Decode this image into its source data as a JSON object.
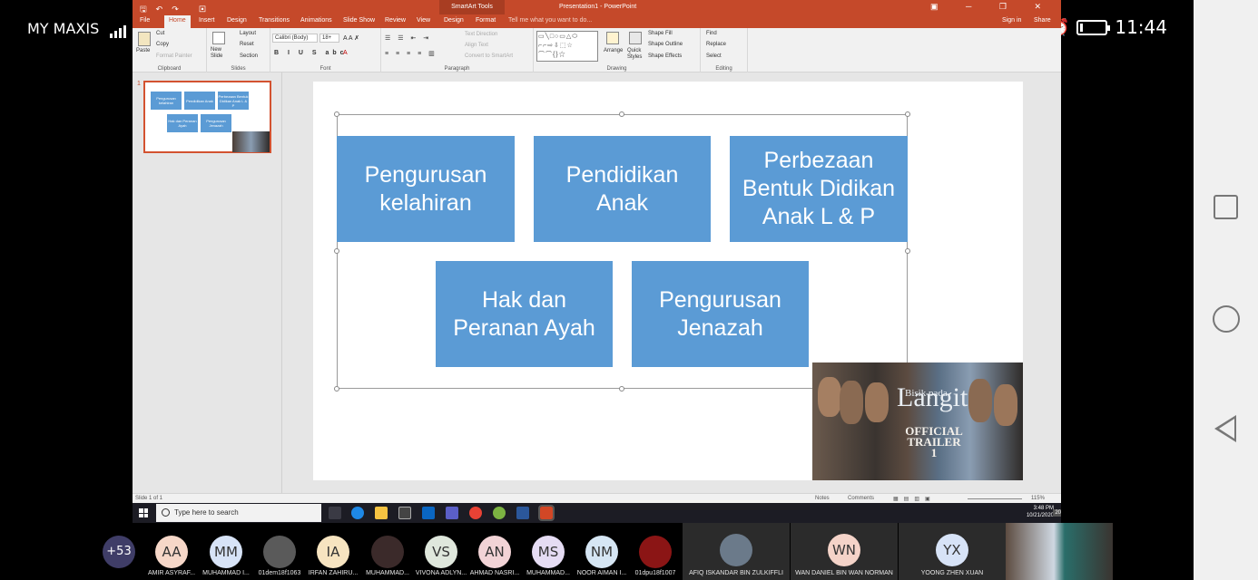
{
  "phone": {
    "carrier": "MY MAXIS",
    "clock": "11:44"
  },
  "ppt": {
    "window_title": "Presentation1 - PowerPoint",
    "context_group": "SmartArt Tools",
    "tabs": [
      "File",
      "Home",
      "Insert",
      "Design",
      "Transitions",
      "Animations",
      "Slide Show",
      "Review",
      "View",
      "Design",
      "Format"
    ],
    "tell_me": "Tell me what you want to do...",
    "sign_in": "Sign in",
    "share": "Share",
    "ribbon": {
      "paste": "Paste",
      "cut": "Cut",
      "copy": "Copy",
      "format_painter": "Format Painter",
      "clipboard": "Clipboard",
      "new_slide": "New Slide",
      "layout": "Layout",
      "reset": "Reset",
      "section": "Section",
      "slides": "Slides",
      "font_name": "Calibri (Body)",
      "font_size": "18+",
      "font": "Font",
      "text_direction": "Text Direction",
      "align_text": "Align Text",
      "convert_smartart": "Convert to SmartArt",
      "paragraph": "Paragraph",
      "arrange": "Arrange",
      "quick_styles": "Quick Styles",
      "shape_fill": "Shape Fill",
      "shape_outline": "Shape Outline",
      "shape_effects": "Shape Effects",
      "drawing": "Drawing",
      "find": "Find",
      "replace": "Replace",
      "select": "Select",
      "editing": "Editing"
    },
    "slide_number": "1",
    "boxes": [
      "Pengurusan kelahiran",
      "Pendidikan Anak",
      "Perbezaan Bentuk Didikan Anak L & P",
      "Hak dan Peranan Ayah",
      "Pengurusan Jenazah"
    ],
    "thumb_boxes": [
      "Pengurusan kelahiran",
      "Pendidikan Anak",
      "Perbezaan Bentuk Didikan Anak L & P",
      "Hak dan Peranan Ayah",
      "Pengurusan Jenazah"
    ],
    "video": {
      "small": "Bisik pada",
      "title": "Langit",
      "trailer": "OFFICIAL TRAILER 1"
    },
    "status": {
      "slide_of": "Slide 1 of 1",
      "notes": "Notes",
      "comments": "Comments",
      "zoom": "115%"
    },
    "taskbar": {
      "search": "Type here to search",
      "time": "3:48 PM",
      "date": "10/21/2020",
      "notif": "20"
    }
  },
  "participants": {
    "more": "+53",
    "people": [
      {
        "initials": "AA",
        "name": "AMIR ASYRAF...",
        "color": "#f6d7c8"
      },
      {
        "initials": "MM",
        "name": "MUHAMMAD I...",
        "color": "#d7e3f7"
      },
      {
        "initials": "",
        "name": "01dem18f1063",
        "color": "#5a5a5a"
      },
      {
        "initials": "IA",
        "name": "IRFAN ZAHIRU...",
        "color": "#f7e4c0"
      },
      {
        "initials": "",
        "name": "MUHAMMAD...",
        "color": "#3b2a2a"
      },
      {
        "initials": "VS",
        "name": "VIVONA ADLYN...",
        "color": "#dfe7dc"
      },
      {
        "initials": "AN",
        "name": "AHMAD NASRI...",
        "color": "#f2d3d6"
      },
      {
        "initials": "MS",
        "name": "MUHAMMAD...",
        "color": "#e5dcf3"
      },
      {
        "initials": "NM",
        "name": "NOOR AIMAN I...",
        "color": "#d6e6f4"
      },
      {
        "initials": "",
        "name": "01dpu18f1007",
        "color": "#8b1515"
      }
    ],
    "tiles": [
      {
        "initials": "",
        "name": "AFIQ ISKANDAR BIN ZULKIFFLI",
        "color": "#6b7a8a"
      },
      {
        "initials": "WN",
        "name": "WAN DANIEL BIN WAN NORMAN",
        "color": "#f4d3c8"
      },
      {
        "initials": "YX",
        "name": "YOONG ZHEN XUAN",
        "color": "#d7e3f7"
      }
    ]
  }
}
